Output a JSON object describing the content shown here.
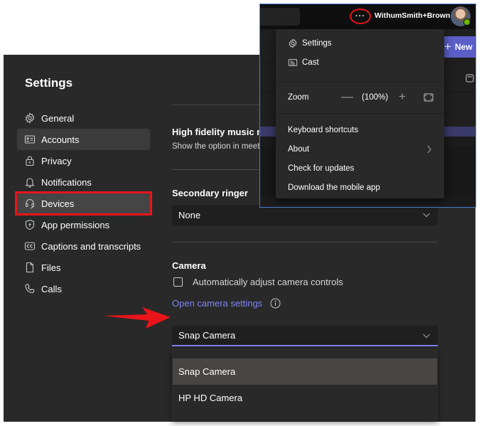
{
  "settings": {
    "title": "Settings",
    "nav": [
      {
        "label": "General",
        "icon": "gear-icon"
      },
      {
        "label": "Accounts",
        "icon": "id-card-icon"
      },
      {
        "label": "Privacy",
        "icon": "lock-icon"
      },
      {
        "label": "Notifications",
        "icon": "bell-icon"
      },
      {
        "label": "Devices",
        "icon": "headset-icon"
      },
      {
        "label": "App permissions",
        "icon": "shield-icon"
      },
      {
        "label": "Captions and transcripts",
        "icon": "cc-icon"
      },
      {
        "label": "Files",
        "icon": "file-icon"
      },
      {
        "label": "Calls",
        "icon": "phone-icon"
      }
    ],
    "active_item": "Devices",
    "hovered_item": "Accounts"
  },
  "content": {
    "hifi_title": "High fidelity music m",
    "hifi_desc": "Show the option in meet",
    "secondary_ringer": {
      "title": "Secondary ringer",
      "value": "None"
    },
    "camera": {
      "title": "Camera",
      "auto_adjust_label": "Automatically adjust camera controls",
      "auto_adjust_checked": false,
      "open_settings_link": "Open camera settings",
      "selected": "Snap Camera",
      "options": [
        "Snap Camera",
        "HP HD Camera"
      ]
    }
  },
  "overlay": {
    "more_label": "···",
    "org_name": "WithumSmith+Brown",
    "presence": "available",
    "new_button": "New",
    "menu": {
      "settings": "Settings",
      "cast": "Cast",
      "zoom_label": "Zoom",
      "zoom_minus": "—",
      "zoom_value": "(100%)",
      "zoom_plus": "+",
      "keyboard_shortcuts": "Keyboard shortcuts",
      "about": "About",
      "check_updates": "Check for updates",
      "download_mobile": "Download the mobile app"
    }
  },
  "colors": {
    "accent": "#7f85f5",
    "brand_button": "#5b5fc7",
    "annotation_red": "#e8141a",
    "presence_green": "#6bb700"
  }
}
